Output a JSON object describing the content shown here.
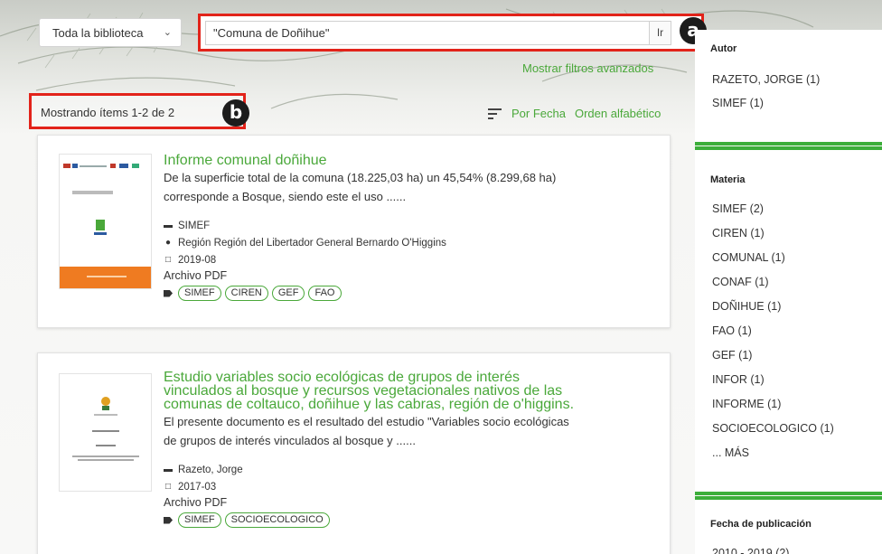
{
  "search": {
    "scope": "Toda la biblioteca",
    "query": "\"Comuna de Doñihue\"",
    "go_label": "Ir",
    "advanced_filters": "Mostrar filtros avanzados"
  },
  "markers": {
    "a": "a",
    "b": "b"
  },
  "results": {
    "showing": "Mostrando ítems 1-2 de 2",
    "sort_by_date": "Por Fecha",
    "sort_alpha": "Orden alfabético",
    "items": [
      {
        "title": "Informe comunal doñihue",
        "description_lines": [
          "De la superficie total de la comuna (18.225,03 ha) un 45,54% (8.299,68 ha)",
          "corresponde a Bosque, siendo este el uso ......"
        ],
        "author": "SIMEF",
        "location": "Región Región del Libertador General Bernardo O'Higgins",
        "date": "2019-08",
        "file_type": "Archivo PDF",
        "tags": [
          "SIMEF",
          "CIREN",
          "GEF",
          "FAO"
        ],
        "thumb_caption": "COMUNA DE DOÑIHUE"
      },
      {
        "title_lines": [
          "Estudio variables socio ecológicas de grupos de interés",
          "vinculados al bosque y recursos vegetacionales nativos de las",
          "comunas de coltauco, doñihue y las cabras, región de o'higgins."
        ],
        "description_lines": [
          "El presente documento es el resultado del estudio \"Variables socio ecológicas",
          "de grupos de interés vinculados al bosque y ......"
        ],
        "author": "Razeto, Jorge",
        "date": "2017-03",
        "file_type": "Archivo PDF",
        "tags": [
          "SIMEF",
          "SOCIOECOLOGICO"
        ]
      }
    ]
  },
  "sidebar": {
    "autor": {
      "heading": "Autor",
      "items": [
        "RAZETO, JORGE (1)",
        "SIMEF (1)"
      ]
    },
    "materia": {
      "heading": "Materia",
      "items": [
        "SIMEF (2)",
        "CIREN (1)",
        "COMUNAL (1)",
        "CONAF (1)",
        "DOÑIHUE (1)",
        "FAO (1)",
        "GEF (1)",
        "INFOR (1)",
        "INFORME (1)",
        "SOCIOECOLOGICO (1)",
        "... MÁS"
      ]
    },
    "fecha": {
      "heading": "Fecha de publicación",
      "items": [
        "2010 - 2019 (2)"
      ]
    }
  },
  "colors": {
    "accent": "#4aa83a",
    "highlight": "#e2231a",
    "panel_rule": "#3cae3a"
  },
  "icons": {
    "author": "user-icon",
    "location": "map-pin-icon",
    "date": "calendar-icon",
    "tags": "tag-icon",
    "sort": "sort-lines-icon",
    "scope": "chevron-down-icon"
  }
}
